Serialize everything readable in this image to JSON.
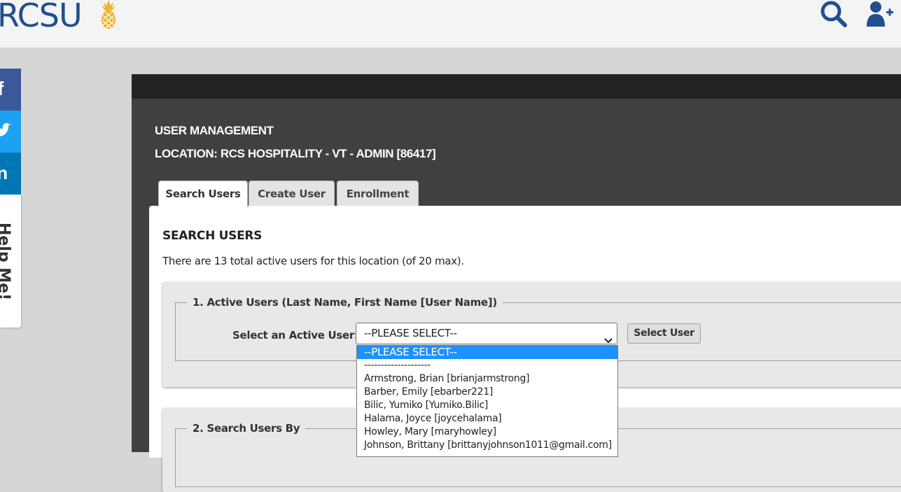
{
  "header": {
    "logo_text": "RCSU",
    "icons": [
      "search-icon",
      "add-user-icon"
    ]
  },
  "social": {
    "items": [
      {
        "glyph": "f",
        "name": "facebook",
        "color": "#3b5998"
      },
      {
        "glyph": "twitter-bird",
        "name": "twitter",
        "color": "#1da1f2"
      },
      {
        "glyph": "in",
        "name": "linkedin",
        "color": "#0077b5"
      }
    ],
    "help_label": "Help Me!"
  },
  "page": {
    "title": "USER MANAGEMENT",
    "location": "LOCATION:  RCS HOSPITALITY - VT - ADMIN [86417]"
  },
  "tabs": [
    {
      "label": "Search Users",
      "active": true
    },
    {
      "label": "Create User",
      "active": false
    },
    {
      "label": "Enrollment",
      "active": false
    }
  ],
  "search": {
    "section_title": "SEARCH USERS",
    "info": "There are 13 total active users for this location (of 20 max).",
    "box1_legend": "1. Active Users (Last Name, First Name [User Name])",
    "select_label": "Select an Active User:",
    "select_value": "--PLEASE SELECT--",
    "select_button": "Select User",
    "box2_legend": "2. Search Users By"
  },
  "dropdown_options": [
    "--PLEASE SELECT--",
    "--------------------",
    "Armstrong, Brian [brianjarmstrong]",
    "Barber, Emily [ebarber221]",
    "Bilic, Yumiko [Yumiko.Bilic]",
    "Halama, Joyce [joycehalama]",
    "Howley, Mary [maryhowley]",
    "Johnson, Brittany [brittanyjohnson1011@gmail.com]"
  ],
  "colors": {
    "brand": "#1f4f8f",
    "pineapple": "#f2b22c",
    "panel_bg": "#404040",
    "panel_top": "#222222",
    "selected_option": "#1e90ff"
  }
}
